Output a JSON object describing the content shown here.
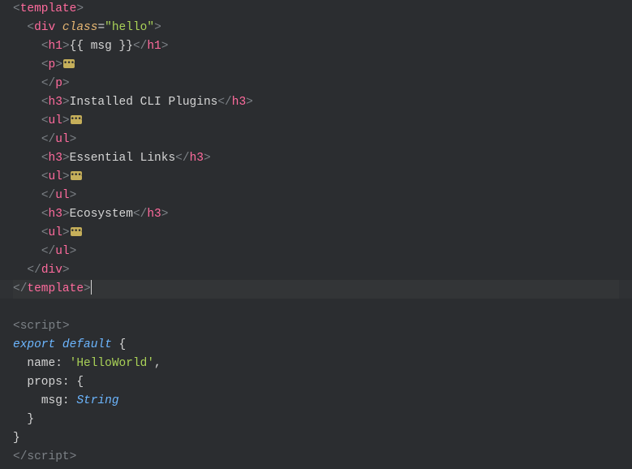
{
  "lines": [
    {
      "indent": 0,
      "type": "open",
      "tag": "template"
    },
    {
      "indent": 2,
      "type": "open",
      "tag": "div",
      "attr": "class",
      "val": "\"hello\""
    },
    {
      "indent": 4,
      "type": "open-text-close",
      "tag": "h1",
      "text": "{{ msg }}"
    },
    {
      "indent": 4,
      "type": "open-fold",
      "tag": "p"
    },
    {
      "indent": 4,
      "type": "close",
      "tag": "p"
    },
    {
      "indent": 4,
      "type": "open-text-close",
      "tag": "h3",
      "text": "Installed CLI Plugins"
    },
    {
      "indent": 4,
      "type": "open-fold",
      "tag": "ul"
    },
    {
      "indent": 4,
      "type": "close",
      "tag": "ul"
    },
    {
      "indent": 4,
      "type": "open-text-close",
      "tag": "h3",
      "text": "Essential Links"
    },
    {
      "indent": 4,
      "type": "open-fold",
      "tag": "ul"
    },
    {
      "indent": 4,
      "type": "close",
      "tag": "ul"
    },
    {
      "indent": 4,
      "type": "open-text-close",
      "tag": "h3",
      "text": "Ecosystem"
    },
    {
      "indent": 4,
      "type": "open-fold",
      "tag": "ul"
    },
    {
      "indent": 4,
      "type": "close",
      "tag": "ul"
    },
    {
      "indent": 2,
      "type": "close",
      "tag": "div"
    },
    {
      "indent": 0,
      "type": "close-cursor",
      "tag": "template"
    },
    {
      "indent": 0,
      "type": "blank"
    },
    {
      "indent": 0,
      "type": "script-open",
      "tag": "script"
    },
    {
      "indent": 0,
      "type": "export-default",
      "kw1": "export",
      "kw2": "default"
    },
    {
      "indent": 2,
      "type": "kv-string",
      "key": "name",
      "val": "'HelloWorld'",
      "comma": true
    },
    {
      "indent": 2,
      "type": "kv-brace",
      "key": "props"
    },
    {
      "indent": 4,
      "type": "kv-type",
      "key": "msg",
      "val": "String"
    },
    {
      "indent": 2,
      "type": "brace-close"
    },
    {
      "indent": 0,
      "type": "brace-close"
    },
    {
      "indent": 0,
      "type": "script-close",
      "tag": "script"
    }
  ]
}
